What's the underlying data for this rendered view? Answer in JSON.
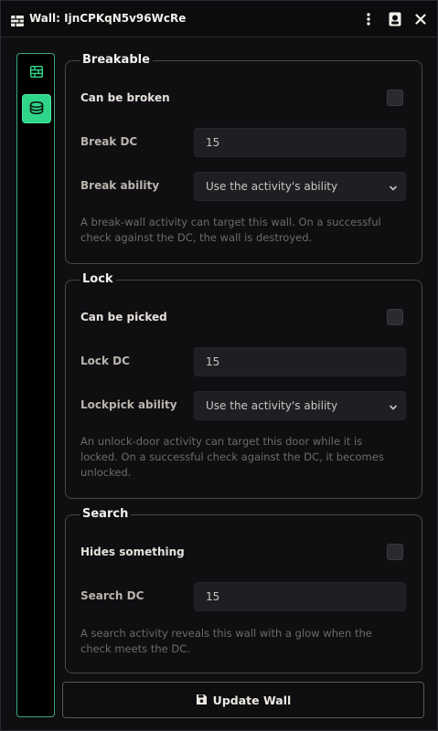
{
  "window": {
    "title": "Wall: IjnCPKqN5v96WcRe",
    "title_icon": "wall-brick-icon",
    "controls": [
      "menu-dots-icon",
      "token-icon",
      "close-icon"
    ]
  },
  "sidebar": {
    "tabs": [
      {
        "icon": "brick-wall-icon",
        "active": false
      },
      {
        "icon": "coins-icon",
        "active": true
      }
    ]
  },
  "sections": {
    "breakable": {
      "legend": "Breakable",
      "toggle_label": "Can be broken",
      "toggle_checked": false,
      "dc_label": "Break DC",
      "dc_value": "15",
      "ability_label": "Break ability",
      "ability_value": "Use the activity's ability",
      "hint": "A break-wall activity can target this wall. On a successful check against the DC, the wall is destroyed."
    },
    "lock": {
      "legend": "Lock",
      "toggle_label": "Can be picked",
      "toggle_checked": false,
      "dc_label": "Lock DC",
      "dc_value": "15",
      "ability_label": "Lockpick ability",
      "ability_value": "Use the activity's ability",
      "hint": "An unlock-door activity can target this door while it is locked. On a successful check against the DC, it becomes unlocked."
    },
    "search": {
      "legend": "Search",
      "toggle_label": "Hides something",
      "toggle_checked": false,
      "dc_label": "Search DC",
      "dc_value": "15",
      "hint": "A search activity reveals this wall with a glow when the check meets the DC."
    }
  },
  "footer": {
    "submit_label": "Update Wall",
    "submit_icon": "save-icon"
  },
  "colors": {
    "accent": "#2fd68a",
    "background": "#0f0e11",
    "field": "#1f1e23"
  }
}
